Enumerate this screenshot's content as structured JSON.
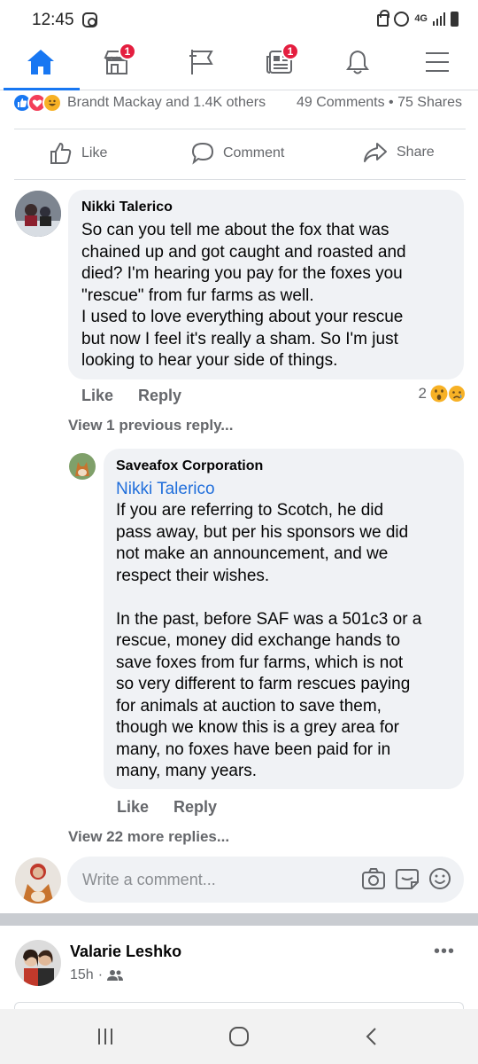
{
  "status_bar": {
    "time": "12:45",
    "network": "4G"
  },
  "top_nav": {
    "items": [
      {
        "icon": "home-icon",
        "active": true
      },
      {
        "icon": "marketplace-icon",
        "badge": "1"
      },
      {
        "icon": "pages-flag-icon"
      },
      {
        "icon": "news-feed-icon",
        "badge": "1"
      },
      {
        "icon": "bell-icon"
      },
      {
        "icon": "menu-icon"
      }
    ],
    "accent_color": "#1877f2"
  },
  "reactions": {
    "emojis": [
      "like-reaction-icon",
      "love-reaction-icon",
      "haha-reaction-icon"
    ],
    "summary": "Brandt Mackay and 1.4K others",
    "comments": "49 Comments",
    "shares": "75 Shares"
  },
  "actions": {
    "like": "Like",
    "comment": "Comment",
    "share": "Share"
  },
  "comments": [
    {
      "author": "Nikki Talerico",
      "text": "So can you tell me about the fox that was\nchained up and got caught and roasted and\ndied? I'm hearing you pay for the foxes you\n\"rescue\" from fur farms as well.\nI used to love everything about your rescue\nbut now I feel it's really a sham. So I'm just\nlooking to hear your side of things.",
      "like_label": "Like",
      "reply_label": "Reply",
      "reaction_count": "2",
      "view_previous": "View 1 previous reply..."
    }
  ],
  "reply": {
    "author": "Saveafox Corporation",
    "mention": "Nikki Talerico",
    "text": "If you are referring to Scotch, he did\npass away, but per his sponsors we did\nnot make an announcement, and we\nrespect their wishes.\n\nIn the past, before SAF was a 501c3 or a\nrescue, money did exchange hands to\nsave foxes from fur farms, which is not\nso very different to farm rescues paying\nfor animals at auction to save them,\nthough we know this is a grey area for\nmany, no foxes have been paid for in\nmany, many years.",
    "like_label": "Like",
    "reply_label": "Reply",
    "view_more": "View 22 more replies..."
  },
  "composer": {
    "placeholder": "Write a comment..."
  },
  "next_post": {
    "author": "Valarie Leshko",
    "time": "15h",
    "more": "•••"
  }
}
